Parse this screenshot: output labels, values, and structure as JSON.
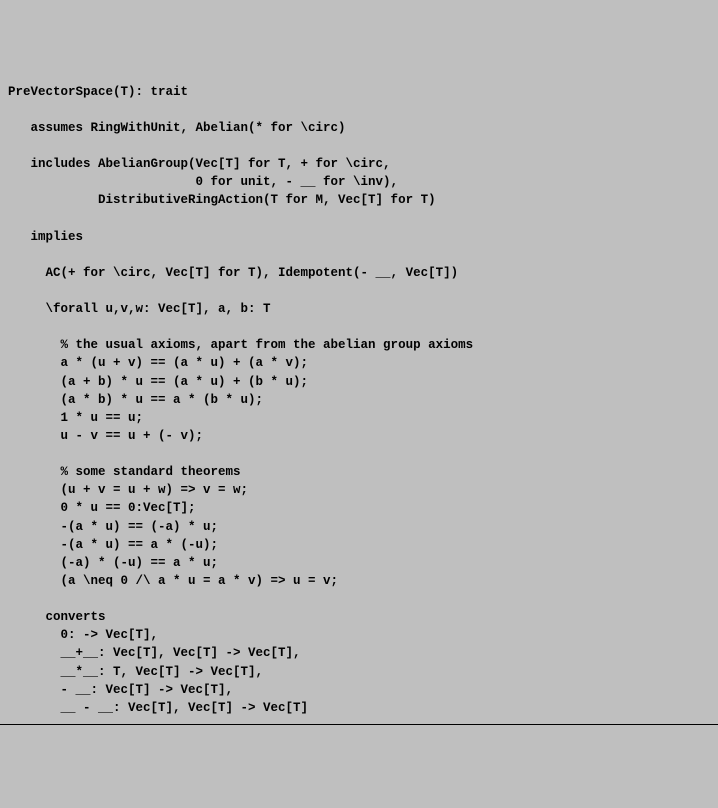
{
  "code": {
    "l01": "PreVectorSpace(T): trait",
    "l02": "",
    "l03": "   assumes RingWithUnit, Abelian(* for \\circ)",
    "l04": "",
    "l05": "   includes AbelianGroup(Vec[T] for T, + for \\circ,",
    "l06": "                         0 for unit, - __ for \\inv),",
    "l07": "            DistributiveRingAction(T for M, Vec[T] for T)",
    "l08": "",
    "l09": "   implies",
    "l10": "",
    "l11": "     AC(+ for \\circ, Vec[T] for T), Idempotent(- __, Vec[T])",
    "l12": "",
    "l13": "     \\forall u,v,w: Vec[T], a, b: T",
    "l14": "",
    "l15": "       % the usual axioms, apart from the abelian group axioms",
    "l16": "       a * (u + v) == (a * u) + (a * v);",
    "l17": "       (a + b) * u == (a * u) + (b * u);",
    "l18": "       (a * b) * u == a * (b * u);",
    "l19": "       1 * u == u;",
    "l20": "       u - v == u + (- v);",
    "l21": "",
    "l22": "       % some standard theorems",
    "l23": "       (u + v = u + w) => v = w;",
    "l24": "       0 * u == 0:Vec[T];",
    "l25": "       -(a * u) == (-a) * u;",
    "l26": "       -(a * u) == a * (-u);",
    "l27": "       (-a) * (-u) == a * u;",
    "l28": "       (a \\neq 0 /\\ a * u = a * v) => u = v;",
    "l29": "",
    "l30": "     converts",
    "l31": "       0: -> Vec[T],",
    "l32": "       __+__: Vec[T], Vec[T] -> Vec[T],",
    "l33": "       __*__: T, Vec[T] -> Vec[T],",
    "l34": "       - __: Vec[T] -> Vec[T],",
    "l35": "       __ - __: Vec[T], Vec[T] -> Vec[T]"
  }
}
